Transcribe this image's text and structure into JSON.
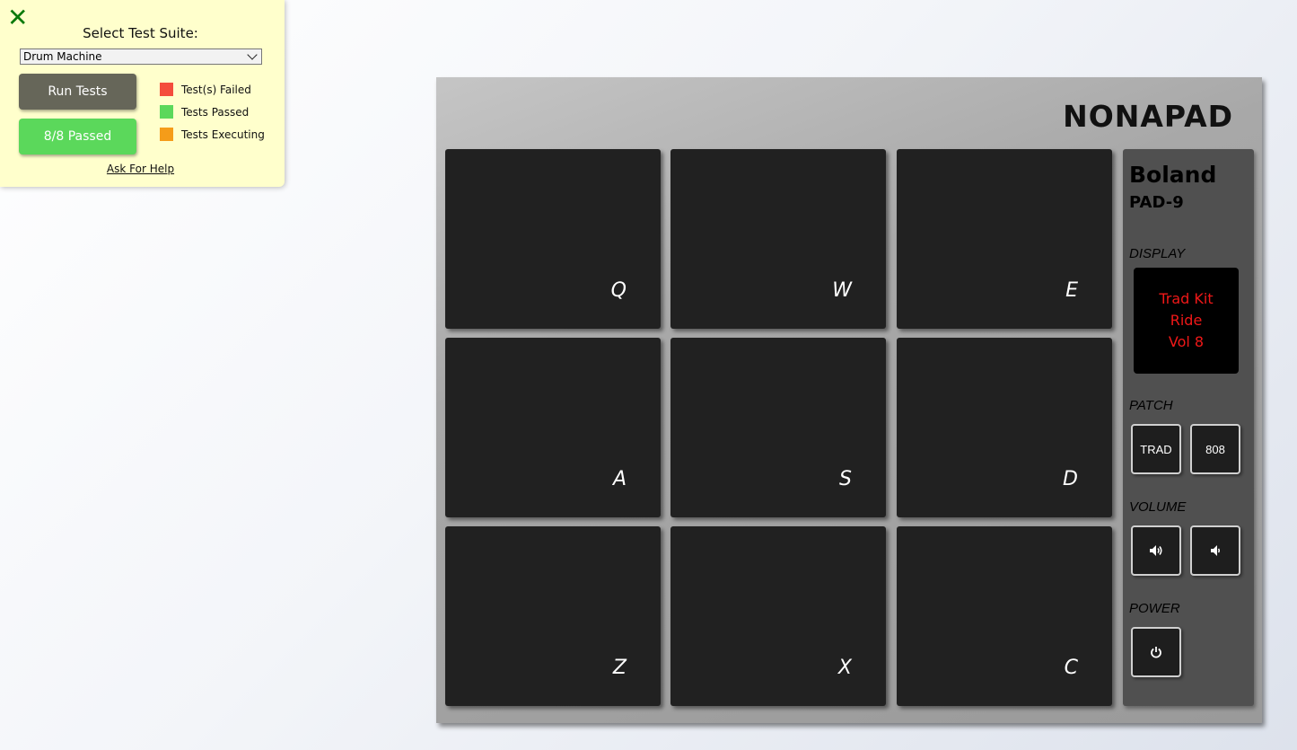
{
  "test_panel": {
    "close_icon": "close-icon",
    "select_label": "Select Test Suite:",
    "selected_suite": "Drum Machine",
    "run_button": "Run Tests",
    "result_button": "8/8 Passed",
    "legend": [
      {
        "label": "Test(s) Failed",
        "color": "#f44d3c"
      },
      {
        "label": "Tests Passed",
        "color": "#5bd85b"
      },
      {
        "label": "Tests Executing",
        "color": "#f59c19"
      }
    ],
    "help_link": "Ask For Help"
  },
  "machine": {
    "title": "NONAPAD",
    "pads": [
      {
        "key": "Q"
      },
      {
        "key": "W"
      },
      {
        "key": "E"
      },
      {
        "key": "A"
      },
      {
        "key": "S"
      },
      {
        "key": "D"
      },
      {
        "key": "Z"
      },
      {
        "key": "X"
      },
      {
        "key": "C"
      }
    ],
    "brand": "Boland",
    "model": "PAD-9",
    "display_label": "DISPLAY",
    "display_lines": [
      "Trad Kit",
      "Ride",
      "Vol 8"
    ],
    "patch_label": "PATCH",
    "patch_buttons": [
      "TRAD",
      "808"
    ],
    "volume_label": "VOLUME",
    "volume_icons": [
      "volume-up-icon",
      "volume-down-icon"
    ],
    "power_label": "POWER",
    "power_icon": "power-icon"
  }
}
